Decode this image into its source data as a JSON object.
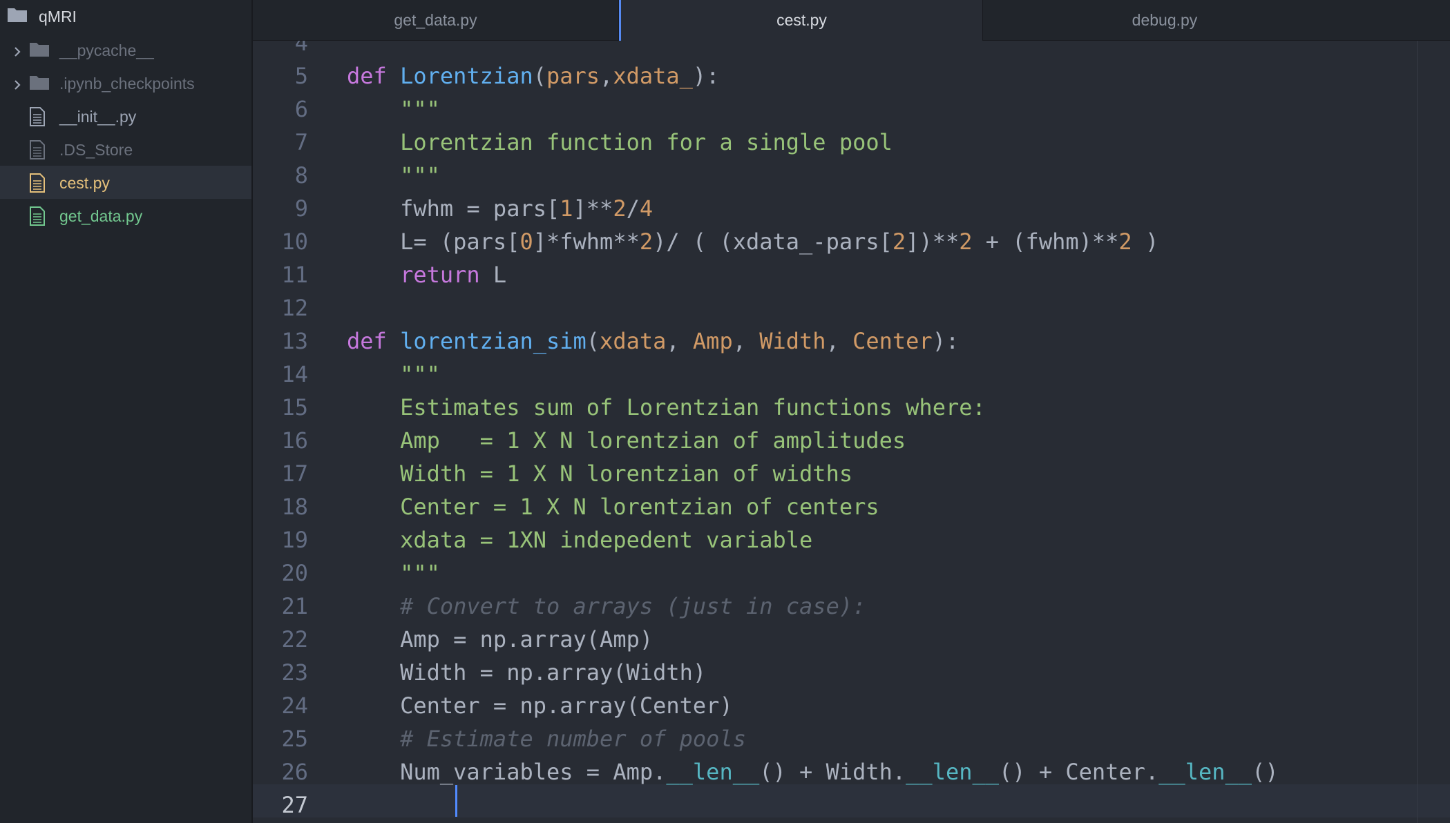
{
  "sidebar": {
    "root": {
      "icon": "folder-icon",
      "label": "qMRI"
    },
    "items": [
      {
        "label": "__pycache__",
        "type": "folder",
        "icon": "folder-icon",
        "status": "ignored"
      },
      {
        "label": ".ipynb_checkpoints",
        "type": "folder",
        "icon": "folder-icon",
        "status": "ignored"
      },
      {
        "label": "__init__.py",
        "type": "file",
        "icon": "file-text-icon",
        "status": "normal"
      },
      {
        "label": ".DS_Store",
        "type": "file",
        "icon": "file-text-icon",
        "status": "ignored"
      },
      {
        "label": "cest.py",
        "type": "file",
        "icon": "file-text-icon",
        "status": "modified",
        "selected": true
      },
      {
        "label": "get_data.py",
        "type": "file",
        "icon": "file-text-icon",
        "status": "added"
      }
    ]
  },
  "tabs": [
    {
      "label": "get_data.py",
      "active": false
    },
    {
      "label": "cest.py",
      "active": true
    },
    {
      "label": "debug.py",
      "active": false
    }
  ],
  "editor": {
    "partial_line_number": "4",
    "current_line": "27",
    "lines": [
      {
        "n": "5",
        "tokens": [
          [
            "kw",
            "def "
          ],
          [
            "fn",
            "Lorentzian"
          ],
          [
            "tx",
            "("
          ],
          [
            "pm",
            "pars"
          ],
          [
            "tx",
            ","
          ],
          [
            "pm",
            "xdata_"
          ],
          [
            "tx",
            "):"
          ]
        ]
      },
      {
        "n": "6",
        "tokens": [
          [
            "tx",
            "    "
          ],
          [
            "st",
            "\"\"\""
          ]
        ]
      },
      {
        "n": "7",
        "tokens": [
          [
            "tx",
            "    "
          ],
          [
            "st",
            "Lorentzian function for a single pool"
          ]
        ]
      },
      {
        "n": "8",
        "tokens": [
          [
            "tx",
            "    "
          ],
          [
            "st",
            "\"\"\""
          ]
        ]
      },
      {
        "n": "9",
        "tokens": [
          [
            "tx",
            "    fwhm = pars["
          ],
          [
            "nu",
            "1"
          ],
          [
            "tx",
            "]**"
          ],
          [
            "nu",
            "2"
          ],
          [
            "tx",
            "/"
          ],
          [
            "nu",
            "4"
          ]
        ]
      },
      {
        "n": "10",
        "tokens": [
          [
            "tx",
            "    L= (pars["
          ],
          [
            "nu",
            "0"
          ],
          [
            "tx",
            "]*fwhm**"
          ],
          [
            "nu",
            "2"
          ],
          [
            "tx",
            ")/ ( (xdata_-pars["
          ],
          [
            "nu",
            "2"
          ],
          [
            "tx",
            "])**"
          ],
          [
            "nu",
            "2"
          ],
          [
            "tx",
            " + (fwhm)**"
          ],
          [
            "nu",
            "2"
          ],
          [
            "tx",
            " )"
          ]
        ]
      },
      {
        "n": "11",
        "tokens": [
          [
            "tx",
            "    "
          ],
          [
            "kw",
            "return"
          ],
          [
            "tx",
            " L"
          ]
        ]
      },
      {
        "n": "12",
        "tokens": []
      },
      {
        "n": "13",
        "tokens": [
          [
            "kw",
            "def "
          ],
          [
            "fn",
            "lorentzian_sim"
          ],
          [
            "tx",
            "("
          ],
          [
            "pm",
            "xdata"
          ],
          [
            "tx",
            ", "
          ],
          [
            "pm",
            "Amp"
          ],
          [
            "tx",
            ", "
          ],
          [
            "pm",
            "Width"
          ],
          [
            "tx",
            ", "
          ],
          [
            "pm",
            "Center"
          ],
          [
            "tx",
            "):"
          ]
        ]
      },
      {
        "n": "14",
        "tokens": [
          [
            "tx",
            "    "
          ],
          [
            "st",
            "\"\"\""
          ]
        ]
      },
      {
        "n": "15",
        "tokens": [
          [
            "tx",
            "    "
          ],
          [
            "st",
            "Estimates sum of Lorentzian functions where:"
          ]
        ]
      },
      {
        "n": "16",
        "tokens": [
          [
            "tx",
            "    "
          ],
          [
            "st",
            "Amp   = 1 X N lorentzian of amplitudes"
          ]
        ]
      },
      {
        "n": "17",
        "tokens": [
          [
            "tx",
            "    "
          ],
          [
            "st",
            "Width = 1 X N lorentzian of widths"
          ]
        ]
      },
      {
        "n": "18",
        "tokens": [
          [
            "tx",
            "    "
          ],
          [
            "st",
            "Center = 1 X N lorentzian of centers"
          ]
        ]
      },
      {
        "n": "19",
        "tokens": [
          [
            "tx",
            "    "
          ],
          [
            "st",
            "xdata = 1XN indepedent variable"
          ]
        ]
      },
      {
        "n": "20",
        "tokens": [
          [
            "tx",
            "    "
          ],
          [
            "st",
            "\"\"\""
          ]
        ]
      },
      {
        "n": "21",
        "tokens": [
          [
            "tx",
            "    "
          ],
          [
            "cm",
            "# Convert to arrays (just in case):"
          ]
        ]
      },
      {
        "n": "22",
        "tokens": [
          [
            "tx",
            "    Amp = np.array(Amp)"
          ]
        ]
      },
      {
        "n": "23",
        "tokens": [
          [
            "tx",
            "    Width = np.array(Width)"
          ]
        ]
      },
      {
        "n": "24",
        "tokens": [
          [
            "tx",
            "    Center = np.array(Center)"
          ]
        ]
      },
      {
        "n": "25",
        "tokens": [
          [
            "tx",
            "    "
          ],
          [
            "cm",
            "# Estimate number of pools"
          ]
        ]
      },
      {
        "n": "26",
        "tokens": [
          [
            "tx",
            "    Num_variables = Amp."
          ],
          [
            "sp",
            "__len__"
          ],
          [
            "tx",
            "() + Width."
          ],
          [
            "sp",
            "__len__"
          ],
          [
            "tx",
            "() + Center."
          ],
          [
            "sp",
            "__len__"
          ],
          [
            "tx",
            "()"
          ]
        ]
      },
      {
        "n": "27",
        "tokens": []
      }
    ]
  },
  "colors": {
    "editor_bg": "#282c34",
    "sidebar_bg": "#21252b",
    "accent": "#568af2",
    "modified": "#e5c07b",
    "added": "#73c990",
    "keyword": "#c678dd",
    "function": "#61afef",
    "string": "#98c379",
    "number": "#d19a66",
    "comment": "#5c6370"
  }
}
